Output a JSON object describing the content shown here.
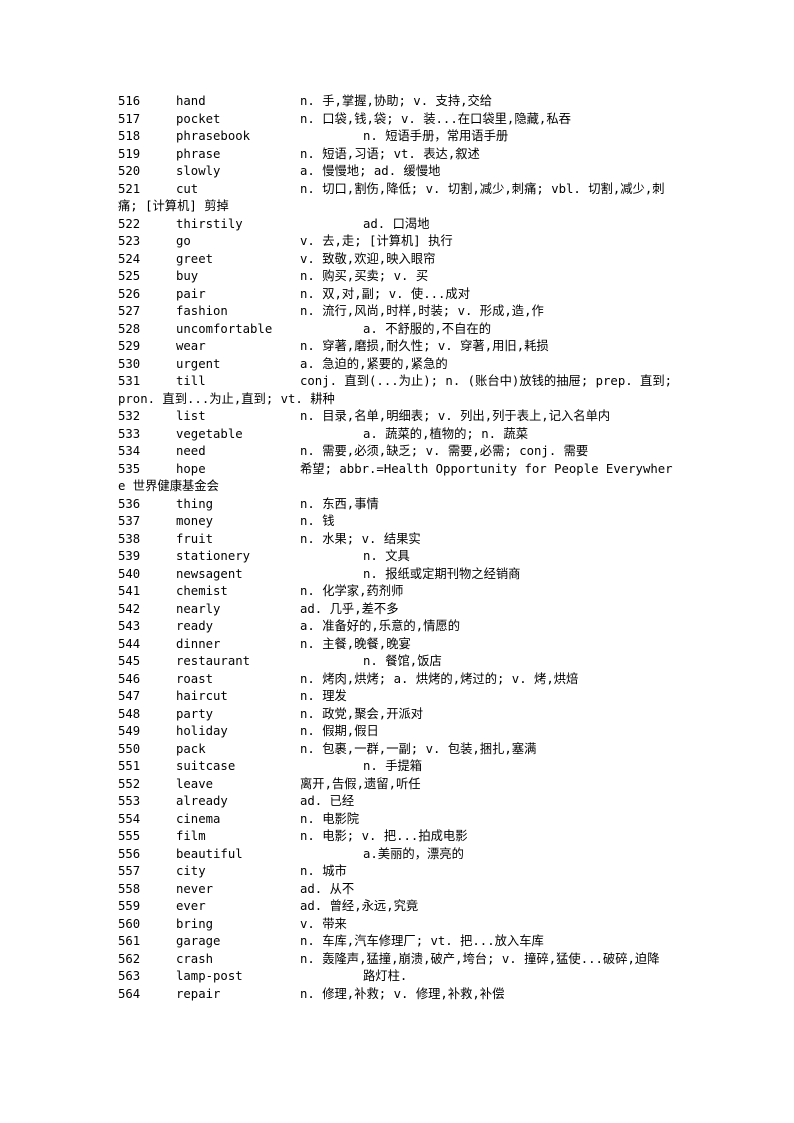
{
  "document": {
    "type": "vocabulary-list",
    "page_background": "#ffffff",
    "text_color": "#000000",
    "entries": [
      {
        "num": "516",
        "word": "hand",
        "def": "n. 手,掌握,协助; v. 支持,交给",
        "stop": 1
      },
      {
        "num": "517",
        "word": "pocket",
        "def": "n. 口袋,钱,袋; v. 装...在口袋里,隐藏,私吞",
        "stop": 1
      },
      {
        "num": "518",
        "word": "phrasebook",
        "def": "n. 短语手册，常用语手册",
        "stop": 2
      },
      {
        "num": "519",
        "word": "phrase",
        "def": "n. 短语,习语; vt. 表达,叙述",
        "stop": 1
      },
      {
        "num": "520",
        "word": "slowly",
        "def": "a. 慢慢地; ad. 缓慢地",
        "stop": 1
      },
      {
        "num": "521",
        "word": "cut",
        "def": "n. 切口,割伤,降低; v. 切割,减少,刺痛; vbl. 切割,减少,刺痛; [计算机] 剪掉",
        "stop": 1
      },
      {
        "num": "522",
        "word": "thirstily",
        "def": "ad. 口渴地",
        "stop": 2
      },
      {
        "num": "523",
        "word": "go",
        "def": "v. 去,走; [计算机] 执行",
        "stop": 1
      },
      {
        "num": "524",
        "word": "greet",
        "def": "v. 致敬,欢迎,映入眼帘",
        "stop": 1
      },
      {
        "num": "525",
        "word": "buy",
        "def": "n. 购买,买卖; v. 买",
        "stop": 1
      },
      {
        "num": "526",
        "word": "pair",
        "def": "n. 双,对,副; v. 使...成对",
        "stop": 1
      },
      {
        "num": "527",
        "word": "fashion",
        "def": "n. 流行,风尚,时样,时装; v. 形成,造,作",
        "stop": 1
      },
      {
        "num": "528",
        "word": "uncomfortable",
        "def": "a. 不舒服的,不自在的",
        "stop": 2
      },
      {
        "num": "529",
        "word": "wear",
        "def": "n. 穿著,磨损,耐久性; v. 穿著,用旧,耗损",
        "stop": 1
      },
      {
        "num": "530",
        "word": "urgent",
        "def": "a. 急迫的,紧要的,紧急的",
        "stop": 1
      },
      {
        "num": "531",
        "word": "till",
        "def": "conj. 直到(...为止); n. (账台中)放钱的抽屉; prep. 直到; pron. 直到...为止,直到; vt. 耕种",
        "stop": 1
      },
      {
        "num": "532",
        "word": "list",
        "def": "n. 目录,名单,明细表; v. 列出,列于表上,记入名单内",
        "stop": 1
      },
      {
        "num": "533",
        "word": "vegetable",
        "def": "a. 蔬菜的,植物的; n. 蔬菜",
        "stop": 2
      },
      {
        "num": "534",
        "word": "need",
        "def": "n. 需要,必须,缺乏; v. 需要,必需; conj. 需要",
        "stop": 1
      },
      {
        "num": "535",
        "word": "hope",
        "def": "希望; abbr.=Health Opportunity for People Everywhere 世界健康基金会",
        "stop": 1
      },
      {
        "num": "536",
        "word": "thing",
        "def": "n. 东西,事情",
        "stop": 1
      },
      {
        "num": "537",
        "word": "money",
        "def": "n. 钱",
        "stop": 1
      },
      {
        "num": "538",
        "word": "fruit",
        "def": "n. 水果; v. 结果实",
        "stop": 1
      },
      {
        "num": "539",
        "word": "stationery",
        "def": "n. 文具",
        "stop": 2
      },
      {
        "num": "540",
        "word": "newsagent",
        "def": "n. 报纸或定期刊物之经销商",
        "stop": 2
      },
      {
        "num": "541",
        "word": "chemist",
        "def": "n. 化学家,药剂师",
        "stop": 1
      },
      {
        "num": "542",
        "word": "nearly",
        "def": "ad. 几乎,差不多",
        "stop": 1
      },
      {
        "num": "543",
        "word": "ready",
        "def": "a. 准备好的,乐意的,情愿的",
        "stop": 1
      },
      {
        "num": "544",
        "word": "dinner",
        "def": "n. 主餐,晚餐,晚宴",
        "stop": 1
      },
      {
        "num": "545",
        "word": "restaurant",
        "def": "n. 餐馆,饭店",
        "stop": 2
      },
      {
        "num": "546",
        "word": "roast",
        "def": "n. 烤肉,烘烤; a. 烘烤的,烤过的; v. 烤,烘焙",
        "stop": 1
      },
      {
        "num": "547",
        "word": "haircut",
        "def": "n. 理发",
        "stop": 1
      },
      {
        "num": "548",
        "word": "party",
        "def": "n. 政党,聚会,开派对",
        "stop": 1
      },
      {
        "num": "549",
        "word": "holiday",
        "def": "n. 假期,假日",
        "stop": 1
      },
      {
        "num": "550",
        "word": "pack",
        "def": "n. 包裹,一群,一副; v. 包装,捆扎,塞满",
        "stop": 1
      },
      {
        "num": "551",
        "word": "suitcase",
        "def": "n. 手提箱",
        "stop": 2
      },
      {
        "num": "552",
        "word": "leave",
        "def": "离开,告假,遗留,听任",
        "stop": 1
      },
      {
        "num": "553",
        "word": "already",
        "def": "ad. 已经",
        "stop": 1
      },
      {
        "num": "554",
        "word": "cinema",
        "def": "n. 电影院",
        "stop": 1
      },
      {
        "num": "555",
        "word": "film",
        "def": "n. 电影; v. 把...拍成电影",
        "stop": 1
      },
      {
        "num": "556",
        "word": "beautiful",
        "def": "a.美丽的，漂亮的",
        "stop": 2
      },
      {
        "num": "557",
        "word": "city",
        "def": "n. 城市",
        "stop": 1
      },
      {
        "num": "558",
        "word": "never",
        "def": "ad. 从不",
        "stop": 1
      },
      {
        "num": "559",
        "word": "ever",
        "def": "ad. 曾经,永远,究竟",
        "stop": 1
      },
      {
        "num": "560",
        "word": "bring",
        "def": "v. 带来",
        "stop": 1
      },
      {
        "num": "561",
        "word": "garage",
        "def": "n. 车库,汽车修理厂; vt. 把...放入车库",
        "stop": 1
      },
      {
        "num": "562",
        "word": "crash",
        "def": "n. 轰隆声,猛撞,崩溃,破产,垮台; v. 撞碎,猛使...破碎,迫降",
        "stop": 1
      },
      {
        "num": "563",
        "word": "lamp-post",
        "def": "路灯柱.",
        "stop": 2
      },
      {
        "num": "564",
        "word": "repair",
        "def": "n. 修理,补救; v. 修理,补救,补偿",
        "stop": 1
      }
    ]
  }
}
